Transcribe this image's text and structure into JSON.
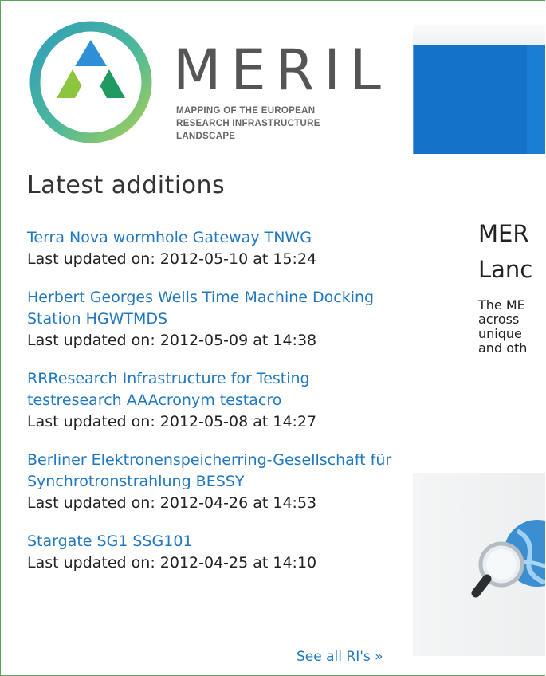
{
  "logo": {
    "wordmark": "MERIL",
    "subtitle_lines": [
      "MAPPING OF THE EUROPEAN",
      "RESEARCH INFRASTRUCTURE",
      "LANDSCAPE"
    ],
    "colors": {
      "ring": "#4db89a",
      "triangle_top": "#2e8fd6",
      "triangle_left": "#8cc63f",
      "triangle_right": "#1f9a63"
    }
  },
  "latest": {
    "title": "Latest additions",
    "items": [
      {
        "name": "Terra Nova wormhole Gateway TNWG",
        "updated": "Last updated on: 2012-05-10 at 15:24"
      },
      {
        "name": "Herbert Georges Wells Time Machine Docking Station HGWTMDS",
        "updated": "Last updated on: 2012-05-09 at 14:38"
      },
      {
        "name": "RRResearch Infrastructure for Testing testresearch AAAcronym testacro",
        "updated": "Last updated on: 2012-05-08 at 14:27"
      },
      {
        "name": "Berliner Elektronenspeicherring-Gesellschaft für Synchrotronstrahlung BESSY",
        "updated": "Last updated on: 2012-04-26 at 14:53"
      },
      {
        "name": "Stargate SG1 SSG101",
        "updated": "Last updated on: 2012-04-25 at 14:10"
      }
    ],
    "see_all": "See all RI's »"
  },
  "intro": {
    "title_lines": [
      "MER",
      "Lanc"
    ],
    "body_lines": [
      "The ME",
      "across",
      "unique",
      "and oth"
    ]
  },
  "colors": {
    "link": "#2178c0",
    "banner": "#1473c6",
    "frame": "#5aa55a"
  }
}
